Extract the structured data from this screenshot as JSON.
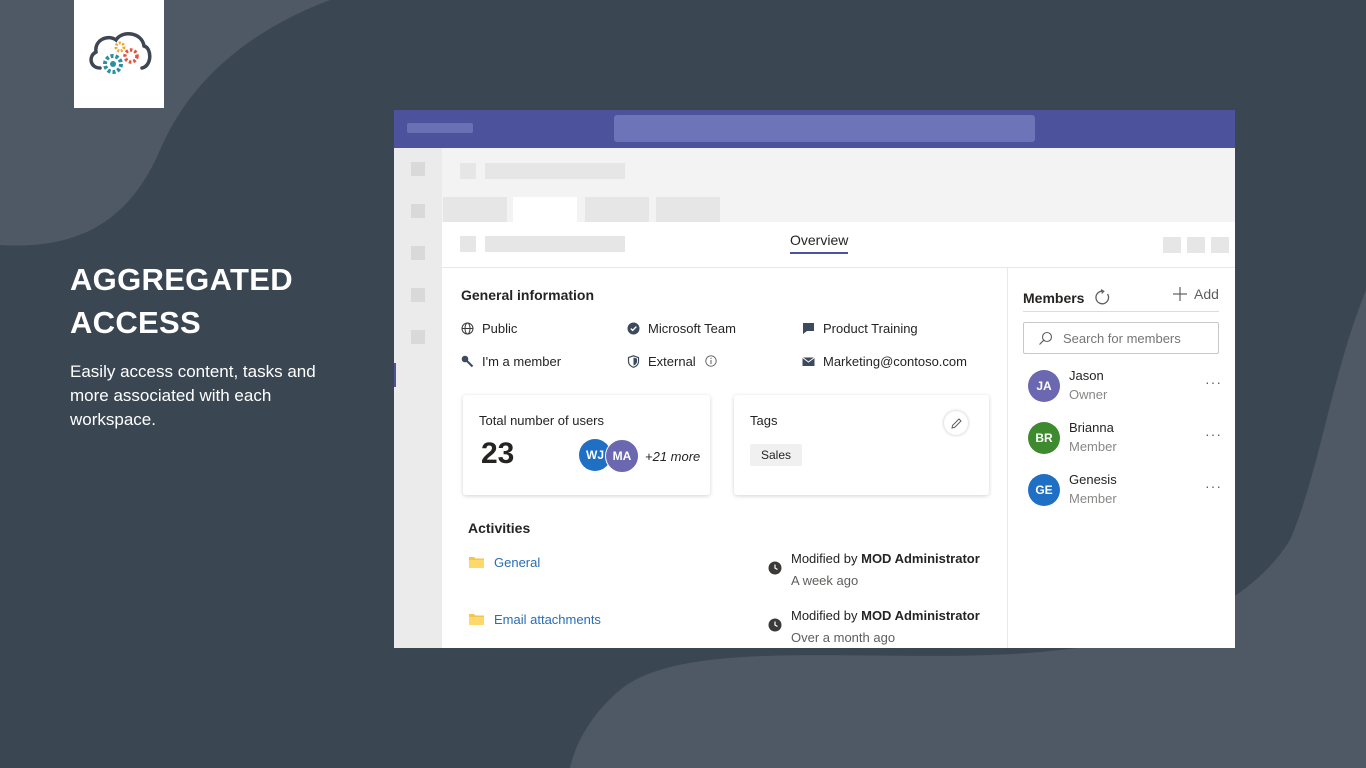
{
  "colors": {
    "background": "#3b4653",
    "accent": "#4c529c",
    "link": "#2a6db5"
  },
  "hero": {
    "title": "AGGREGATED ACCESS",
    "subtitle": "Easily access content, tasks and more associated with each workspace."
  },
  "app": {
    "active_tab": "Overview",
    "general": {
      "title": "General information",
      "items": [
        {
          "icon": "globe-icon",
          "label": "Public"
        },
        {
          "icon": "verified-badge-icon",
          "label": "Microsoft Team"
        },
        {
          "icon": "template-icon",
          "label": "Product Training"
        },
        {
          "icon": "key-icon",
          "label": "I'm a member"
        },
        {
          "icon": "shield-icon",
          "label": "External"
        },
        {
          "icon": "mail-icon",
          "label": "Marketing@contoso.com"
        }
      ]
    },
    "users_card": {
      "label": "Total number of users",
      "count": "23",
      "avatars": [
        {
          "initials": "WJ",
          "color": "#1f6fc5"
        },
        {
          "initials": "MA",
          "color": "#6b67b0"
        }
      ],
      "more": "+21 more"
    },
    "tags_card": {
      "label": "Tags",
      "tags": [
        "Sales"
      ]
    },
    "activities": {
      "title": "Activities",
      "items": [
        {
          "name": "General",
          "modified_prefix": "Modified by",
          "modified_by": "MOD Administrator",
          "time": "A week ago"
        },
        {
          "name": "Email attachments",
          "modified_prefix": "Modified by",
          "modified_by": "MOD Administrator",
          "time": "Over a month ago"
        }
      ]
    },
    "members": {
      "title": "Members",
      "add_label": "Add",
      "search_placeholder": "Search for members",
      "list": [
        {
          "initials": "JA",
          "name": "Jason",
          "role": "Owner",
          "color": "#6b67b0"
        },
        {
          "initials": "BR",
          "name": "Brianna",
          "role": "Member",
          "color": "#3e8a2f"
        },
        {
          "initials": "GE",
          "name": "Genesis",
          "role": "Member",
          "color": "#1f6fc5"
        }
      ]
    }
  }
}
